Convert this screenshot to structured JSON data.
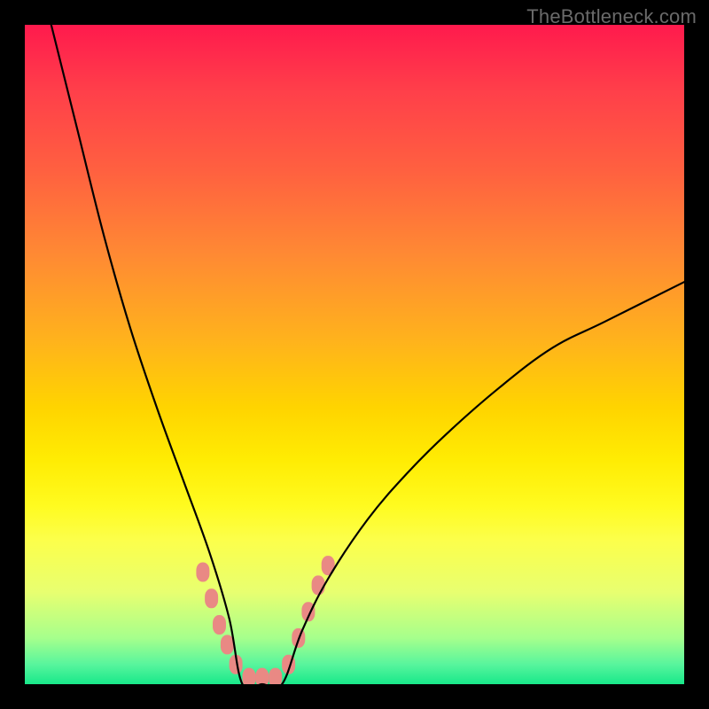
{
  "watermark": "TheBottleneck.com",
  "colors": {
    "frame": "#000000",
    "curve_stroke": "#000000",
    "marker_fill": "#e98984",
    "gradient_stops": [
      "#ff1a4d",
      "#ff3f4a",
      "#ff6040",
      "#ff8a33",
      "#ffb31c",
      "#ffd400",
      "#ffec03",
      "#fffb20",
      "#fcff4a",
      "#e8ff70",
      "#a6ff8c",
      "#58f59d",
      "#18e88a"
    ]
  },
  "chart_data": {
    "type": "line",
    "title": "",
    "xlabel": "",
    "ylabel": "",
    "xlim": [
      0,
      100
    ],
    "ylim": [
      0,
      100
    ],
    "note": "V-shaped bottleneck curve. y is percentage height (0 bottom, 100 top). Minimum (0) ≈ x 33–39. Left arm starts very high (≈100 at x≈4) and drops steeply; right arm rises more gently, reaching ≈61 at x=100.",
    "series": [
      {
        "name": "bottleneck-curve",
        "x": [
          4,
          8,
          12,
          16,
          20,
          24,
          28,
          31,
          33,
          36,
          39,
          42,
          46,
          52,
          58,
          64,
          72,
          80,
          88,
          100
        ],
        "y": [
          100,
          84,
          68,
          54,
          42,
          31,
          20,
          10,
          0,
          0,
          0,
          8,
          16,
          25,
          32,
          38,
          45,
          51,
          55,
          61
        ]
      }
    ],
    "markers": {
      "name": "highlight-dots",
      "note": "Salmon rounded markers clustered at the bottom of the V on both arms.",
      "points": [
        {
          "x": 27.0,
          "y": 17
        },
        {
          "x": 28.3,
          "y": 13
        },
        {
          "x": 29.5,
          "y": 9
        },
        {
          "x": 30.7,
          "y": 6
        },
        {
          "x": 32.0,
          "y": 3
        },
        {
          "x": 34.0,
          "y": 1
        },
        {
          "x": 36.0,
          "y": 1
        },
        {
          "x": 38.0,
          "y": 1
        },
        {
          "x": 40.0,
          "y": 3
        },
        {
          "x": 41.5,
          "y": 7
        },
        {
          "x": 43.0,
          "y": 11
        },
        {
          "x": 44.5,
          "y": 15
        },
        {
          "x": 46.0,
          "y": 18
        }
      ]
    }
  }
}
